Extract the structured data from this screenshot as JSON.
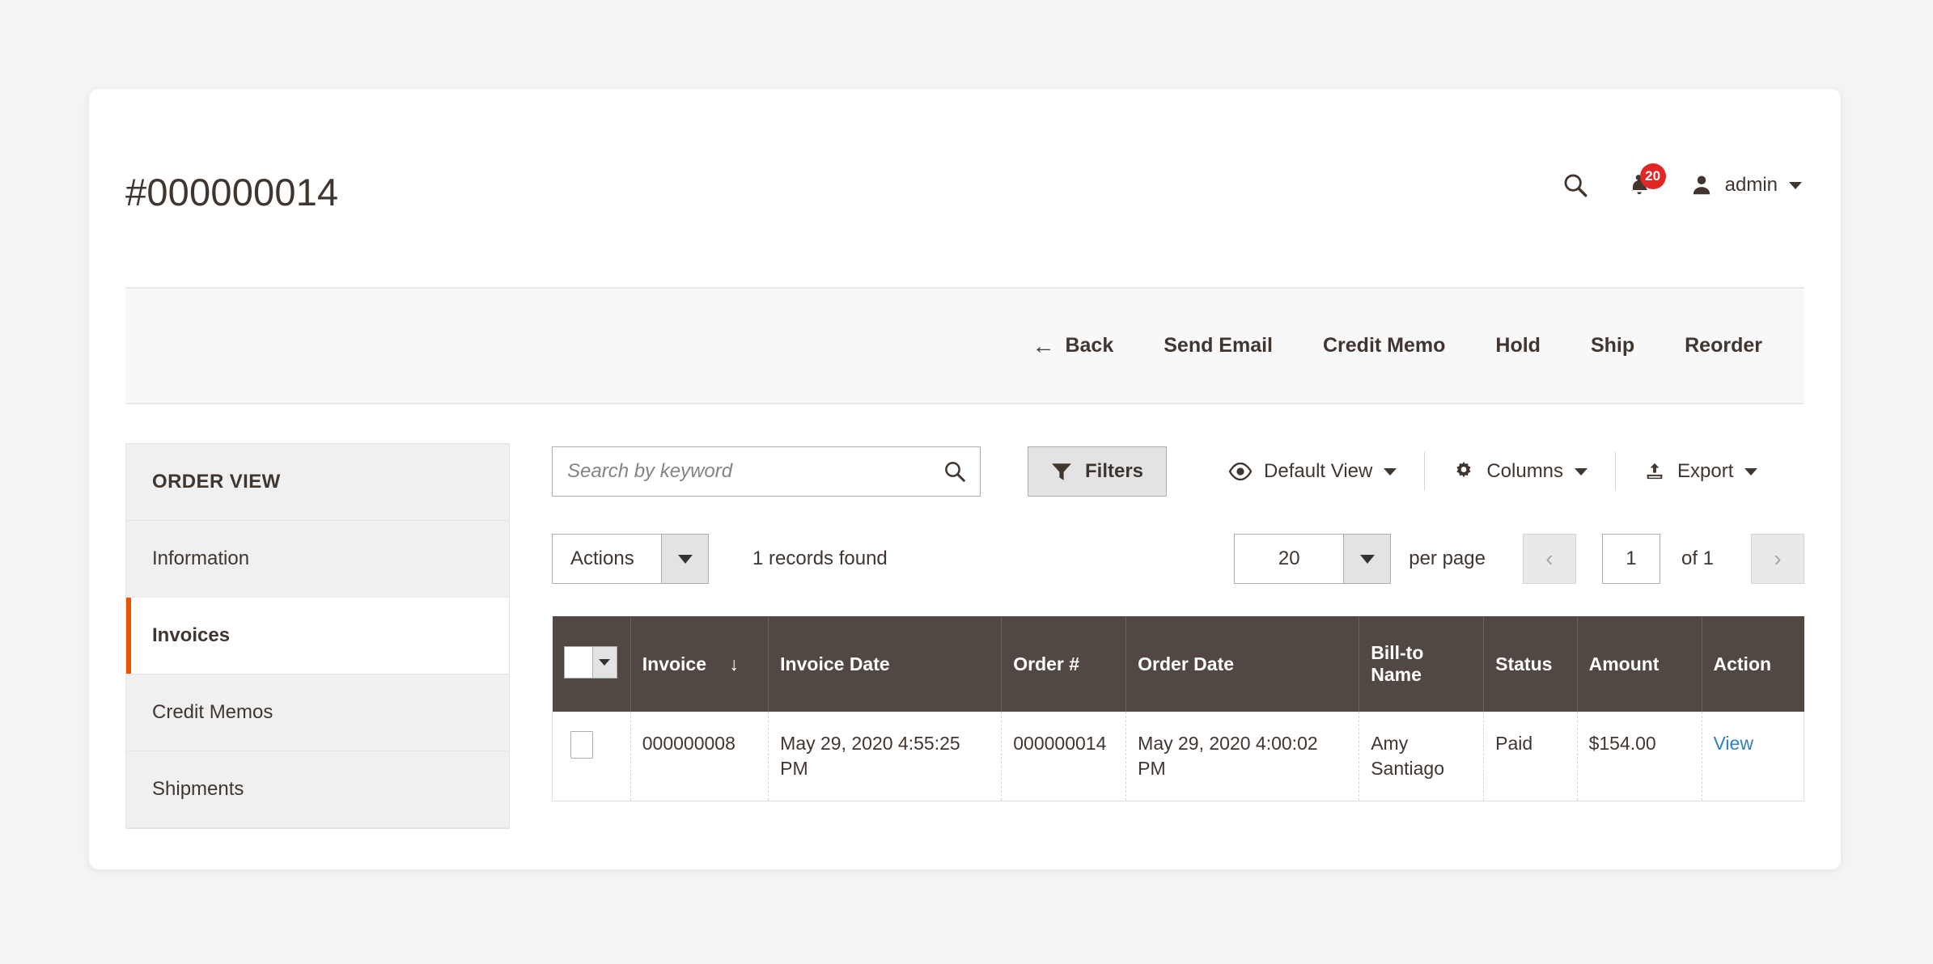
{
  "header": {
    "title": "#000000014",
    "search_icon": "search-icon",
    "notifications": {
      "icon": "bell-icon",
      "count": "20"
    },
    "user": {
      "icon": "user-icon",
      "name": "admin",
      "caret": "chevron-down-icon"
    }
  },
  "actions": [
    {
      "label": "Back",
      "icon": "arrow-left-icon"
    },
    {
      "label": "Send Email",
      "icon": ""
    },
    {
      "label": "Credit Memo",
      "icon": ""
    },
    {
      "label": "Hold",
      "icon": ""
    },
    {
      "label": "Ship",
      "icon": ""
    },
    {
      "label": "Reorder",
      "icon": ""
    }
  ],
  "sidebar": {
    "title": "ORDER VIEW",
    "items": [
      {
        "label": "Information",
        "active": false
      },
      {
        "label": "Invoices",
        "active": true
      },
      {
        "label": "Credit Memos",
        "active": false
      },
      {
        "label": "Shipments",
        "active": false
      }
    ]
  },
  "toolbar": {
    "search_placeholder": "Search by keyword",
    "search_value": "",
    "search_icon": "search-icon",
    "filters_label": "Filters",
    "filters_icon": "funnel-icon",
    "view_label": "Default View",
    "view_icon": "eye-icon",
    "columns_label": "Columns",
    "columns_icon": "gear-icon",
    "export_label": "Export",
    "export_icon": "export-upload-icon"
  },
  "grid_meta": {
    "actions_label": "Actions",
    "records_found": "1 records found",
    "per_page_value": "20",
    "per_page_label": "per page",
    "prev_icon": "chevron-left-icon",
    "next_icon": "chevron-right-icon",
    "page_value": "1",
    "page_total": "of 1"
  },
  "table": {
    "columns": [
      {
        "key": "checkbox",
        "label": "",
        "sorted": false
      },
      {
        "key": "invoice",
        "label": "Invoice",
        "sorted": true,
        "sort_dir": "↓"
      },
      {
        "key": "invoice_date",
        "label": "Invoice Date",
        "sorted": false
      },
      {
        "key": "order_num",
        "label": "Order #",
        "sorted": false
      },
      {
        "key": "order_date",
        "label": "Order Date",
        "sorted": false
      },
      {
        "key": "bill_to_name",
        "label": "Bill-to Name",
        "sorted": false
      },
      {
        "key": "status",
        "label": "Status",
        "sorted": false
      },
      {
        "key": "amount",
        "label": "Amount",
        "sorted": false
      },
      {
        "key": "action",
        "label": "Action",
        "sorted": false
      }
    ],
    "rows": [
      {
        "invoice": "000000008",
        "invoice_date": "May 29, 2020 4:55:25 PM",
        "order_num": "000000014",
        "order_date": "May 29, 2020 4:00:02 PM",
        "bill_to_name": "Amy Santiago",
        "status": "Paid",
        "amount": "$154.00",
        "action": "View"
      }
    ]
  },
  "colors": {
    "accent_orange": "#eb5202",
    "table_header": "#514843",
    "badge_red": "#e22626",
    "link_blue": "#2f7fc1",
    "text": "#41362f"
  }
}
